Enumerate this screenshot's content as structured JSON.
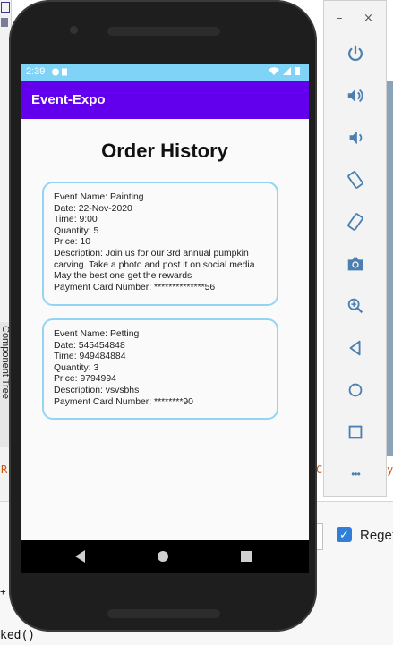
{
  "ide": {
    "component_tree_label": "Component Tree",
    "regex_label": "Regex",
    "code_fragment": "ked()",
    "code_fragment_top": "+",
    "red_letter_left": "R",
    "red_letter_right": "C",
    "orange_letter_right": "y"
  },
  "status_bar": {
    "time": "2:39"
  },
  "app_bar": {
    "title": "Event-Expo"
  },
  "page": {
    "title": "Order History"
  },
  "orders": [
    {
      "lines": [
        "Event Name: Painting",
        "Date: 22-Nov-2020",
        "Time: 9:00",
        "Quantity: 5",
        "Price: 10",
        "Description: Join us for our 3rd annual pumpkin",
        "carving. Take a photo and post it on social media.",
        "May the best one get the rewards",
        "Payment Card Number: **************56"
      ]
    },
    {
      "lines": [
        "Event Name: Petting",
        "Date: 545454848",
        "Time: 949484884",
        "Quantity: 3",
        "Price: 9794994",
        "Description: vsvsbhs",
        "Payment Card Number: ********90"
      ]
    }
  ],
  "emulator": {
    "minimize_glyph": "–",
    "close_glyph": "×",
    "more_glyph": "•••",
    "buttons": [
      "power-icon",
      "volume-up-icon",
      "volume-down-icon",
      "rotate-left-icon",
      "rotate-right-icon",
      "camera-icon",
      "zoom-icon",
      "back-icon",
      "home-icon",
      "overview-icon",
      "more-icon"
    ]
  },
  "colors": {
    "app_bar": "#6200ee",
    "status_bar": "#7fd3f7",
    "card_border": "#93d4f5",
    "emulator_icon": "#4a7fb0"
  }
}
